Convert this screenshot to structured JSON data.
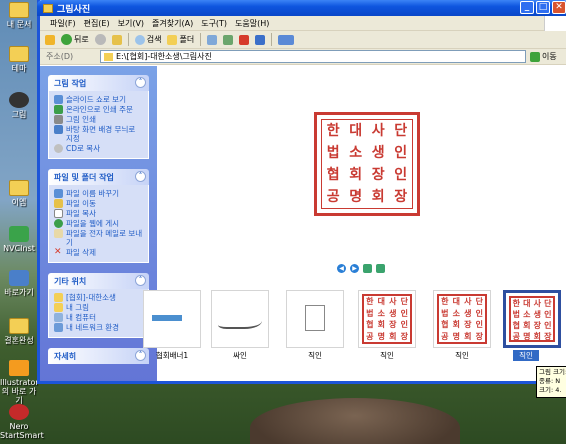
{
  "window": {
    "title": "그림사진",
    "min": "_",
    "max": "□",
    "close": "✕"
  },
  "menubar": [
    "파일(F)",
    "편집(E)",
    "보기(V)",
    "즐겨찾기(A)",
    "도구(T)",
    "도움말(H)"
  ],
  "toolbar": {
    "back": "뒤로",
    "search": "검색",
    "folders": "폴더"
  },
  "address": {
    "label": "주소(D)",
    "value": "E:\\[협회]-대한소생\\그림사진",
    "go": "이동"
  },
  "tasks": {
    "picture": {
      "title": "그림 작업",
      "items": [
        "슬라이드 쇼로 보기",
        "온라인으로 인쇄 주문",
        "그림 인쇄",
        "바탕 화면 배경 무늬로 지정",
        "CD로 복사"
      ]
    },
    "file": {
      "title": "파일 및 폴더 작업",
      "items": [
        "파일 이름 바꾸기",
        "파일 이동",
        "파일 복사",
        "파일을 웹에 게시",
        "파일을 전자 메일로 보내기",
        "파일 삭제"
      ]
    },
    "other": {
      "title": "기타 위치",
      "items": [
        "[협회]-대한소생",
        "내 그림",
        "내 컴퓨터",
        "내 네트워크 환경"
      ]
    },
    "details": {
      "title": "자세히"
    }
  },
  "seal": {
    "chars": [
      "한",
      "대",
      "사",
      "단",
      "법",
      "소",
      "생",
      "인",
      "협",
      "회",
      "장",
      "인",
      "공",
      "명",
      "회",
      "장"
    ]
  },
  "thumbnails": [
    {
      "label": "협회배너1"
    },
    {
      "label": "싸인"
    },
    {
      "label": "직인"
    },
    {
      "label": "직인"
    },
    {
      "label": "직인"
    },
    {
      "label": "직인"
    }
  ],
  "tooltip": {
    "lines": [
      "그림 크기:",
      "종류: N",
      "크기: 4."
    ]
  },
  "desktop": {
    "icons": [
      "내 문서",
      "테마",
      "그림",
      "이엠",
      "NVCInst",
      "바로가기",
      "결혼완성",
      "Illustrator의 바로 가기",
      "Nero StartSmart"
    ]
  },
  "colors": {
    "seal_red": "#c93a32",
    "xp_blue": "#0e55df",
    "selection": "#316ac5"
  }
}
